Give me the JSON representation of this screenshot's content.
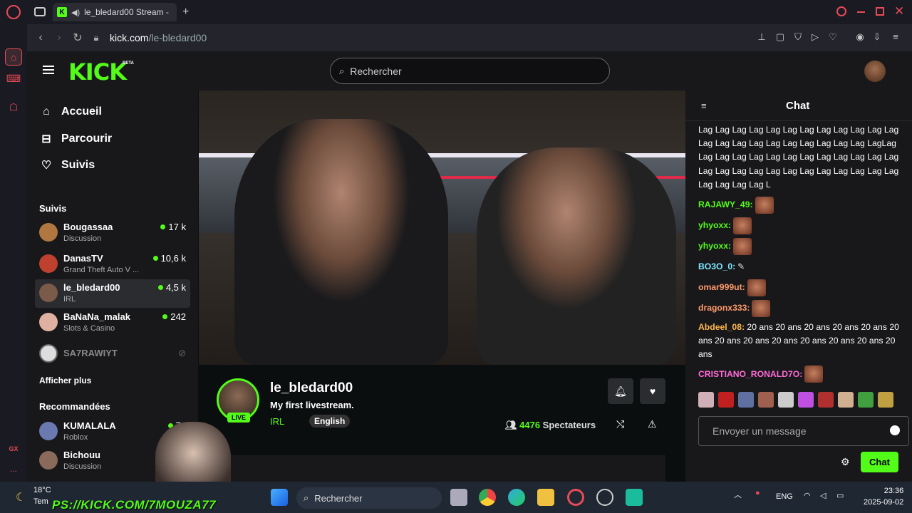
{
  "browser": {
    "tab_title": "le_bledard00 Stream -",
    "url_host": "kick.com",
    "url_path": "/le-bledard00"
  },
  "opera_sidebar": {
    "gx_label": "GX",
    "more_label": "..."
  },
  "header": {
    "logo": "KICK",
    "beta": "BETA",
    "search_placeholder": "Rechercher"
  },
  "nav": {
    "home": "Accueil",
    "browse": "Parcourir",
    "following": "Suivis"
  },
  "followed": {
    "title": "Suivis",
    "items": [
      {
        "name": "Bougassaa",
        "category": "Discussion",
        "viewers": "17 k"
      },
      {
        "name": "DanasTV",
        "category": "Grand Theft Auto V ...",
        "viewers": "10,6 k"
      },
      {
        "name": "le_bledard00",
        "category": "IRL",
        "viewers": "4,5 k"
      },
      {
        "name": "BaNaNa_malak",
        "category": "Slots & Casino",
        "viewers": "242"
      },
      {
        "name": "SA7RAWIYT",
        "category": "",
        "viewers": ""
      }
    ],
    "show_more": "Afficher plus"
  },
  "recommended": {
    "title": "Recommandées",
    "items": [
      {
        "name": "KUMALALA",
        "category": "Roblox",
        "viewers": "76"
      },
      {
        "name": "Bichouu",
        "category": "Discussion",
        "viewers": ""
      }
    ]
  },
  "stream": {
    "channel": "le_bledard00",
    "title": "My first livestream.",
    "category": "IRL",
    "language": "English",
    "live_badge": "LIVE",
    "viewers_count": "4476",
    "viewers_label": "Spectateurs"
  },
  "chat": {
    "title": "Chat",
    "spam_text": "Lag Lag Lag Lag Lag Lag Lag Lag Lag Lag Lag Lag Lag Lag Lag Lag Lag Lag Lag Lag Lag Lag LagLag Lag Lag Lag Lag Lag Lag Lag Lag Lag Lag Lag Lag Lag Lag Lag Lag Lag Lag Lag Lag Lag Lag Lag Lag Lag Lag Lag Lag L",
    "messages": [
      {
        "user": "RAJAWY_49:",
        "color": "#53fc18",
        "text": ""
      },
      {
        "user": "yhyoxx:",
        "color": "#53fc18",
        "text": ""
      },
      {
        "user": "yhyoxx:",
        "color": "#53fc18",
        "text": ""
      },
      {
        "user": "BO3O_0:",
        "color": "#7ee8ff",
        "text": ""
      },
      {
        "user": "omar999ut:",
        "color": "#ff9a6a",
        "text": ""
      },
      {
        "user": "dragonx333:",
        "color": "#ff9a6a",
        "text": ""
      },
      {
        "user": "Abdeel_08:",
        "color": "#ffb84a",
        "text": "20 ans 20 ans 20 ans 20 ans 20 ans 20 ans 20 ans 20 ans 20 ans 20 ans 20 ans 20 ans 20 ans"
      },
      {
        "user": "CRISTIANO_RONALD7O:",
        "color": "#ff6ad5",
        "text": ""
      }
    ],
    "input_placeholder": "Envoyer un message",
    "send_label": "Chat"
  },
  "taskbar": {
    "temp": "18°C",
    "temp_sub": "Tem",
    "search": "Rechercher",
    "lang": "ENG",
    "time": "23:36",
    "date": "2025-09-02"
  },
  "overlay": {
    "banner": "PS://KICK.COM/7MOUZA77"
  },
  "colors": {
    "accent": "#53fc18",
    "bg": "#0b0e0f",
    "panel": "#18181b"
  }
}
